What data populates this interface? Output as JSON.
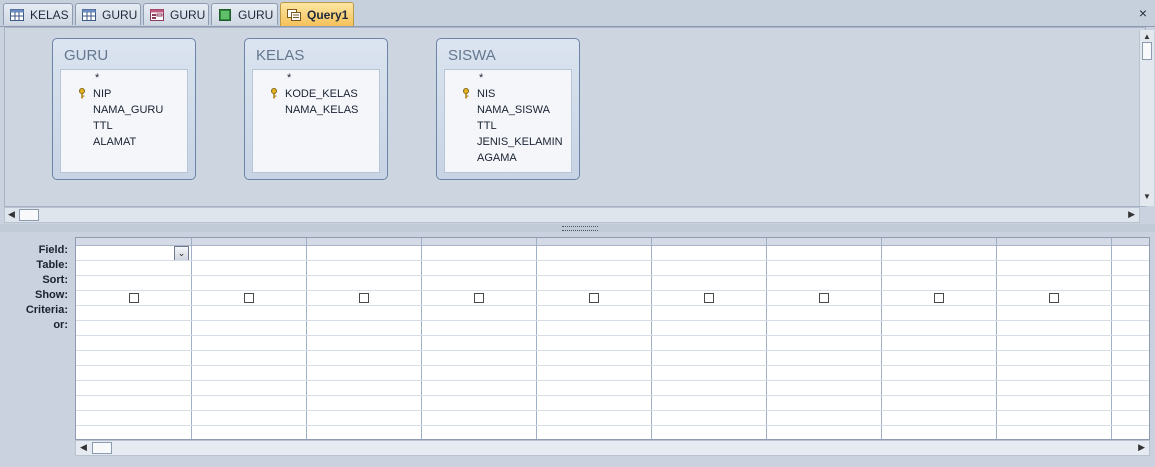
{
  "tabs": [
    {
      "label": "KELAS",
      "icon": "table-icon"
    },
    {
      "label": "GURU",
      "icon": "table-icon"
    },
    {
      "label": "GURU",
      "icon": "form-icon"
    },
    {
      "label": "GURU",
      "icon": "report-icon"
    },
    {
      "label": "Query1",
      "icon": "query-icon",
      "active": true
    }
  ],
  "close_label": "×",
  "tables": [
    {
      "name": "GURU",
      "fields": [
        {
          "label": "*",
          "key": false
        },
        {
          "label": "NIP",
          "key": true
        },
        {
          "label": "NAMA_GURU",
          "key": false
        },
        {
          "label": "TTL",
          "key": false
        },
        {
          "label": "ALAMAT",
          "key": false
        }
      ]
    },
    {
      "name": "KELAS",
      "fields": [
        {
          "label": "*",
          "key": false
        },
        {
          "label": "KODE_KELAS",
          "key": true
        },
        {
          "label": "NAMA_KELAS",
          "key": false
        }
      ]
    },
    {
      "name": "SISWA",
      "fields": [
        {
          "label": "*",
          "key": false
        },
        {
          "label": "NIS",
          "key": true
        },
        {
          "label": "NAMA_SISWA",
          "key": false
        },
        {
          "label": "TTL",
          "key": false
        },
        {
          "label": "JENIS_KELAMIN",
          "key": false
        },
        {
          "label": "AGAMA",
          "key": false
        }
      ]
    }
  ],
  "grid": {
    "row_labels": [
      "Field:",
      "Table:",
      "Sort:",
      "Show:",
      "Criteria:",
      "or:"
    ],
    "column_count": 9
  },
  "colors": {
    "active_tab": "#f5c15a",
    "background": "#c9d2de"
  }
}
